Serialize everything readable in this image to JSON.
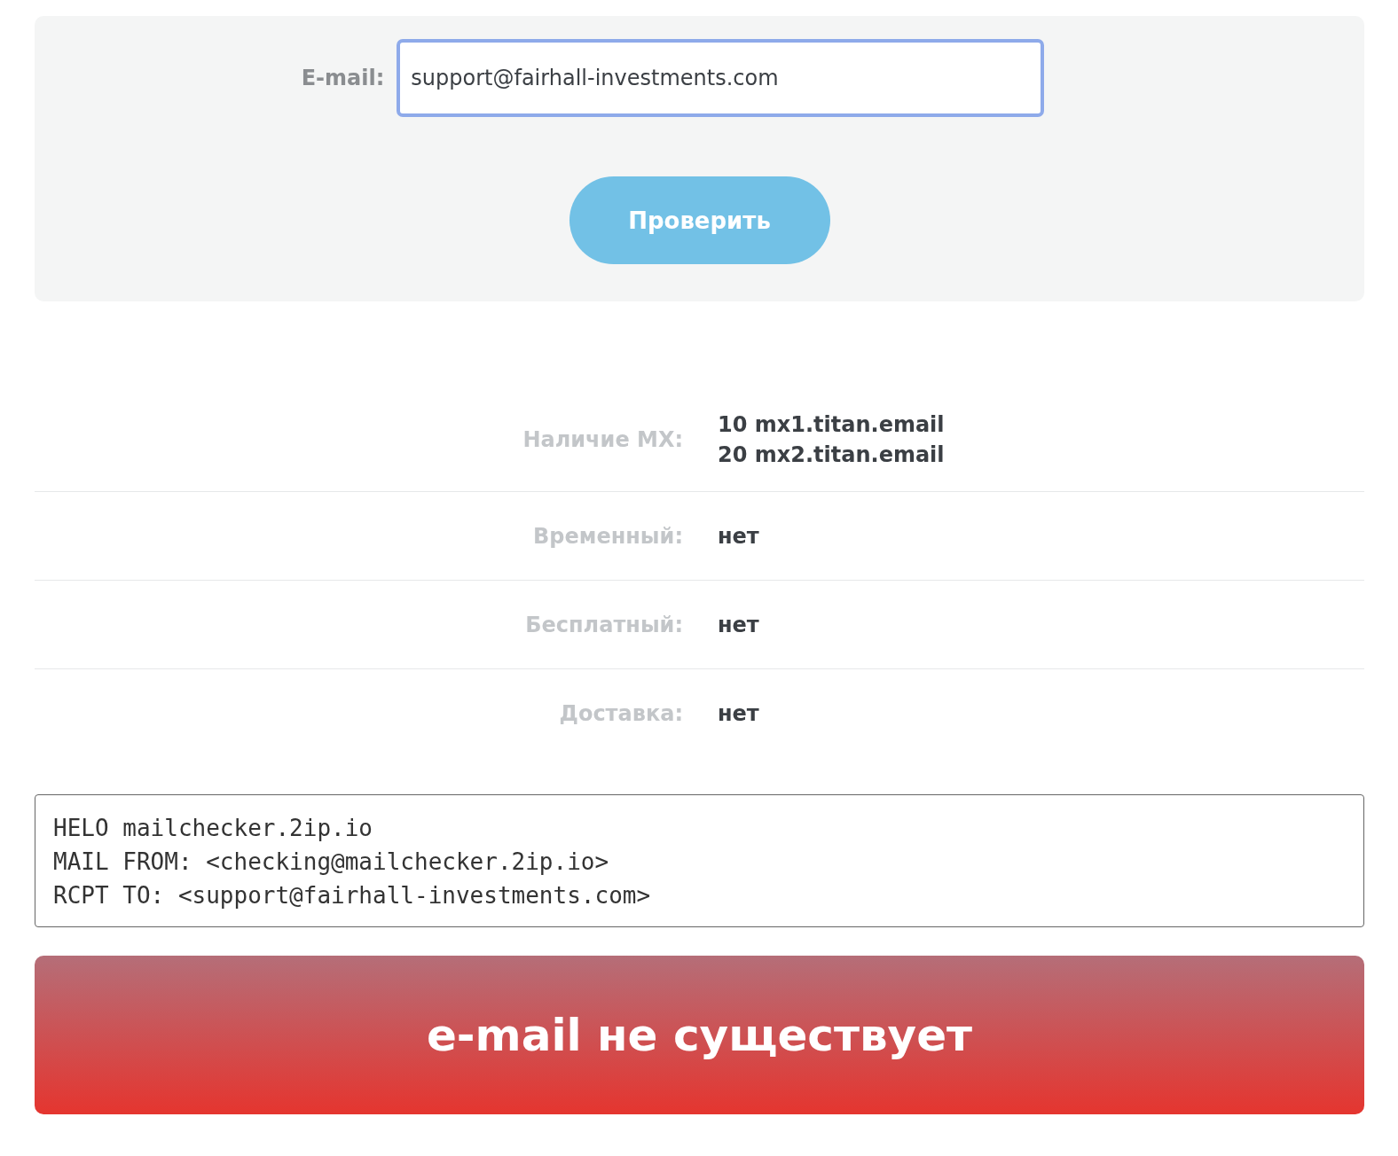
{
  "form": {
    "email_label": "E-mail:",
    "email_value": "support@fairhall-investments.com",
    "submit_button": "Проверить"
  },
  "results": [
    {
      "label": "Наличие MX:",
      "values": [
        "**10** mx1.titan.email",
        "**20** mx2.titan.email"
      ]
    },
    {
      "label": "Временный:",
      "values": [
        "нет"
      ]
    },
    {
      "label": "Бесплатный:",
      "values": [
        "нет"
      ]
    },
    {
      "label": "Доставка:",
      "values": [
        "нет"
      ]
    }
  ],
  "smtp_log": [
    "HELO mailchecker.2ip.io",
    "MAIL FROM: <checking@mailchecker.2ip.io>",
    "RCPT TO: <support@fairhall-investments.com>"
  ],
  "verdict": "e-mail не существует"
}
